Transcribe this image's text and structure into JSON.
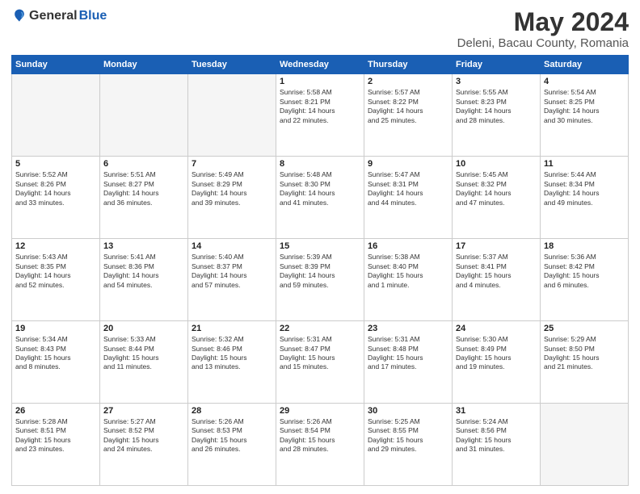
{
  "header": {
    "logo_general": "General",
    "logo_blue": "Blue",
    "month_title": "May 2024",
    "location": "Deleni, Bacau County, Romania"
  },
  "calendar": {
    "headers": [
      "Sunday",
      "Monday",
      "Tuesday",
      "Wednesday",
      "Thursday",
      "Friday",
      "Saturday"
    ],
    "rows": [
      [
        {
          "day": "",
          "info": ""
        },
        {
          "day": "",
          "info": ""
        },
        {
          "day": "",
          "info": ""
        },
        {
          "day": "1",
          "info": "Sunrise: 5:58 AM\nSunset: 8:21 PM\nDaylight: 14 hours\nand 22 minutes."
        },
        {
          "day": "2",
          "info": "Sunrise: 5:57 AM\nSunset: 8:22 PM\nDaylight: 14 hours\nand 25 minutes."
        },
        {
          "day": "3",
          "info": "Sunrise: 5:55 AM\nSunset: 8:23 PM\nDaylight: 14 hours\nand 28 minutes."
        },
        {
          "day": "4",
          "info": "Sunrise: 5:54 AM\nSunset: 8:25 PM\nDaylight: 14 hours\nand 30 minutes."
        }
      ],
      [
        {
          "day": "5",
          "info": "Sunrise: 5:52 AM\nSunset: 8:26 PM\nDaylight: 14 hours\nand 33 minutes."
        },
        {
          "day": "6",
          "info": "Sunrise: 5:51 AM\nSunset: 8:27 PM\nDaylight: 14 hours\nand 36 minutes."
        },
        {
          "day": "7",
          "info": "Sunrise: 5:49 AM\nSunset: 8:29 PM\nDaylight: 14 hours\nand 39 minutes."
        },
        {
          "day": "8",
          "info": "Sunrise: 5:48 AM\nSunset: 8:30 PM\nDaylight: 14 hours\nand 41 minutes."
        },
        {
          "day": "9",
          "info": "Sunrise: 5:47 AM\nSunset: 8:31 PM\nDaylight: 14 hours\nand 44 minutes."
        },
        {
          "day": "10",
          "info": "Sunrise: 5:45 AM\nSunset: 8:32 PM\nDaylight: 14 hours\nand 47 minutes."
        },
        {
          "day": "11",
          "info": "Sunrise: 5:44 AM\nSunset: 8:34 PM\nDaylight: 14 hours\nand 49 minutes."
        }
      ],
      [
        {
          "day": "12",
          "info": "Sunrise: 5:43 AM\nSunset: 8:35 PM\nDaylight: 14 hours\nand 52 minutes."
        },
        {
          "day": "13",
          "info": "Sunrise: 5:41 AM\nSunset: 8:36 PM\nDaylight: 14 hours\nand 54 minutes."
        },
        {
          "day": "14",
          "info": "Sunrise: 5:40 AM\nSunset: 8:37 PM\nDaylight: 14 hours\nand 57 minutes."
        },
        {
          "day": "15",
          "info": "Sunrise: 5:39 AM\nSunset: 8:39 PM\nDaylight: 14 hours\nand 59 minutes."
        },
        {
          "day": "16",
          "info": "Sunrise: 5:38 AM\nSunset: 8:40 PM\nDaylight: 15 hours\nand 1 minute."
        },
        {
          "day": "17",
          "info": "Sunrise: 5:37 AM\nSunset: 8:41 PM\nDaylight: 15 hours\nand 4 minutes."
        },
        {
          "day": "18",
          "info": "Sunrise: 5:36 AM\nSunset: 8:42 PM\nDaylight: 15 hours\nand 6 minutes."
        }
      ],
      [
        {
          "day": "19",
          "info": "Sunrise: 5:34 AM\nSunset: 8:43 PM\nDaylight: 15 hours\nand 8 minutes."
        },
        {
          "day": "20",
          "info": "Sunrise: 5:33 AM\nSunset: 8:44 PM\nDaylight: 15 hours\nand 11 minutes."
        },
        {
          "day": "21",
          "info": "Sunrise: 5:32 AM\nSunset: 8:46 PM\nDaylight: 15 hours\nand 13 minutes."
        },
        {
          "day": "22",
          "info": "Sunrise: 5:31 AM\nSunset: 8:47 PM\nDaylight: 15 hours\nand 15 minutes."
        },
        {
          "day": "23",
          "info": "Sunrise: 5:31 AM\nSunset: 8:48 PM\nDaylight: 15 hours\nand 17 minutes."
        },
        {
          "day": "24",
          "info": "Sunrise: 5:30 AM\nSunset: 8:49 PM\nDaylight: 15 hours\nand 19 minutes."
        },
        {
          "day": "25",
          "info": "Sunrise: 5:29 AM\nSunset: 8:50 PM\nDaylight: 15 hours\nand 21 minutes."
        }
      ],
      [
        {
          "day": "26",
          "info": "Sunrise: 5:28 AM\nSunset: 8:51 PM\nDaylight: 15 hours\nand 23 minutes."
        },
        {
          "day": "27",
          "info": "Sunrise: 5:27 AM\nSunset: 8:52 PM\nDaylight: 15 hours\nand 24 minutes."
        },
        {
          "day": "28",
          "info": "Sunrise: 5:26 AM\nSunset: 8:53 PM\nDaylight: 15 hours\nand 26 minutes."
        },
        {
          "day": "29",
          "info": "Sunrise: 5:26 AM\nSunset: 8:54 PM\nDaylight: 15 hours\nand 28 minutes."
        },
        {
          "day": "30",
          "info": "Sunrise: 5:25 AM\nSunset: 8:55 PM\nDaylight: 15 hours\nand 29 minutes."
        },
        {
          "day": "31",
          "info": "Sunrise: 5:24 AM\nSunset: 8:56 PM\nDaylight: 15 hours\nand 31 minutes."
        },
        {
          "day": "",
          "info": ""
        }
      ]
    ]
  }
}
